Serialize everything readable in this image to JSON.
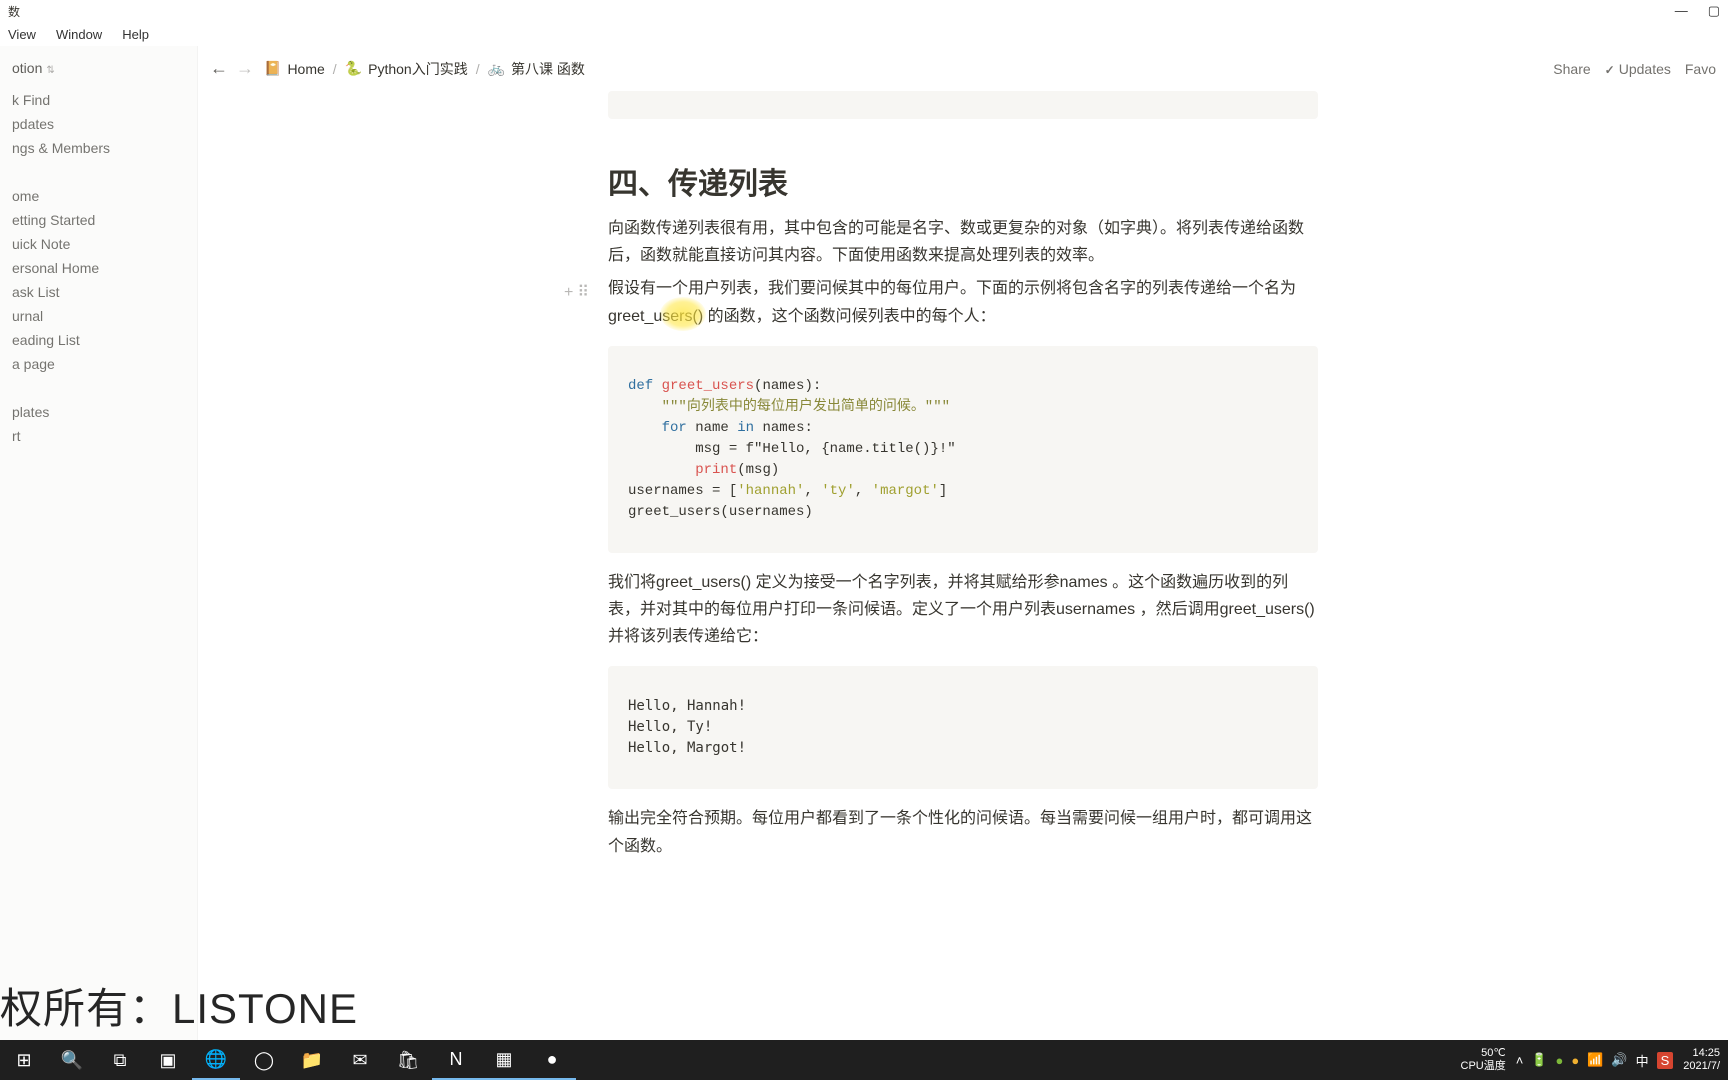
{
  "window": {
    "title_suffix": "数",
    "controls": {
      "minimize": "—",
      "maximize": "▢"
    }
  },
  "menubar": [
    "View",
    "Window",
    "Help"
  ],
  "sidebar": {
    "workspace": "otion",
    "top_items": [
      "k Find",
      "pdates",
      "ngs & Members"
    ],
    "pages": [
      "ome",
      "etting Started",
      "uick Note",
      "ersonal Home",
      "ask List",
      "urnal",
      "eading List",
      "a page"
    ],
    "bottom": [
      "plates",
      "rt"
    ]
  },
  "topbar": {
    "breadcrumb": [
      {
        "icon": "📔",
        "label": "Home"
      },
      {
        "icon": "🐍",
        "label": "Python入门实践"
      },
      {
        "icon": "🚲",
        "label": "第八课 函数"
      }
    ],
    "actions": {
      "share": "Share",
      "updates": "Updates",
      "favorite": "Favo"
    }
  },
  "content": {
    "heading": "四、传递列表",
    "para1": "向函数传递列表很有用，其中包含的可能是名字、数或更复杂的对象（如字典）。将列表传递给函数后，函数就能直接访问其内容。下面使用函数来提高处理列表的效率。",
    "para2": "假设有一个用户列表，我们要问候其中的每位用户。下面的示例将包含名字的列表传递给一个名为greet_users() 的函数，这个函数问候列表中的每个人：",
    "code": {
      "l1_def": "def",
      "l1_fn": "greet_users",
      "l1_rest": "(names):",
      "l2_doc": "\"\"\"向列表中的每位用户发出简单的问候。\"\"\"",
      "l3_for": "for",
      "l3_name": " name ",
      "l3_in": "in",
      "l3_rest": " names:",
      "l4": "        msg = f\"Hello, {name.title()}!\"",
      "l5_print": "print",
      "l5_rest": "(msg)",
      "l6_a": "usernames = [",
      "l6_s1": "'hannah'",
      "l6_c1": ", ",
      "l6_s2": "'ty'",
      "l6_c2": ", ",
      "l6_s3": "'margot'",
      "l6_e": "]",
      "l7": "greet_users(usernames)"
    },
    "para3": "我们将greet_users() 定义为接受一个名字列表，并将其赋给形参names 。这个函数遍历收到的列表，并对其中的每位用户打印一条问候语。定义了一个用户列表usernames ，然后调用greet_users() 并将该列表传递给它：",
    "output": "Hello, Hannah!\nHello, Ty!\nHello, Margot!",
    "para4": "输出完全符合预期。每位用户都看到了一条个性化的问候语。每当需要问候一组用户时，都可调用这个函数。"
  },
  "watermark": "权所有：LISTONE",
  "taskbar": {
    "temp": "50℃",
    "temp_label": "CPU温度",
    "ime1": "中",
    "ime2": "S",
    "time": "14:25",
    "date": "2021/7/"
  }
}
